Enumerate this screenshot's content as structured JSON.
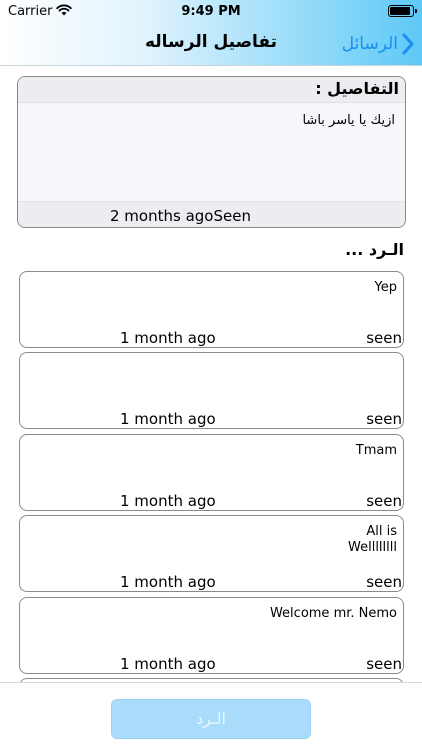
{
  "status_bar": {
    "carrier": "Carrier",
    "time": "9:49 PM",
    "wifi_icon": "wifi-icon",
    "battery_icon": "battery-icon"
  },
  "nav": {
    "title": "تفاصيل الرساله",
    "back_label": "الرسائل",
    "back_icon": "chevron-right-icon",
    "accent_color": "#1a8ff0"
  },
  "details": {
    "heading": "التفاصيل :",
    "message": "ازيك يا ياسر باشا",
    "meta": "2 months agoSeen"
  },
  "replies_title": "الـرد ...",
  "replies": [
    {
      "text": "Yep",
      "date": "1 month ago",
      "status": "seen"
    },
    {
      "text": "",
      "date": "1 month ago",
      "status": "seen"
    },
    {
      "text": "Tmam",
      "date": "1 month ago",
      "status": "seen"
    },
    {
      "text": "All is Wellllllll",
      "date": "1 month ago",
      "status": "seen"
    },
    {
      "text": "Welcome mr. Nemo",
      "date": "1 month ago",
      "status": "seen"
    }
  ],
  "reply_button": {
    "label": "الـرد",
    "color": "#a9dcfb"
  }
}
